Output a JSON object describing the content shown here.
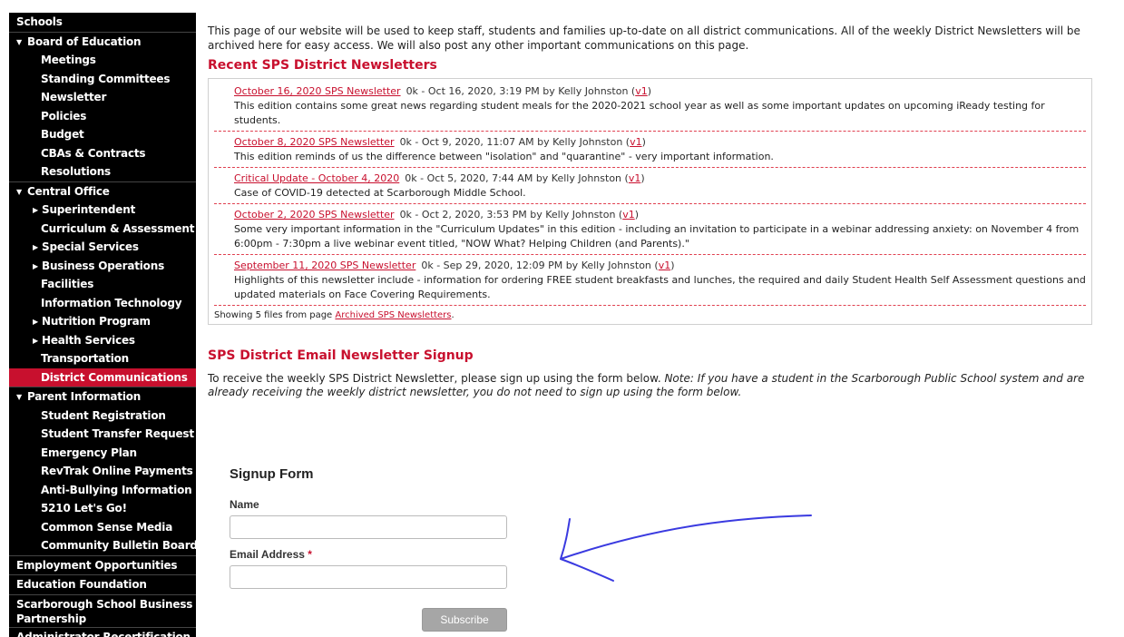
{
  "sidebar": {
    "items": [
      {
        "label": "Schools",
        "level": 0
      },
      {
        "label": "Board of Education",
        "level": 0,
        "expanded": true
      },
      {
        "label": "Meetings",
        "level": 1
      },
      {
        "label": "Standing Committees",
        "level": 1
      },
      {
        "label": "Newsletter",
        "level": 1
      },
      {
        "label": "Policies",
        "level": 1
      },
      {
        "label": "Budget",
        "level": 1
      },
      {
        "label": "CBAs & Contracts",
        "level": 1
      },
      {
        "label": "Resolutions",
        "level": 1
      },
      {
        "label": "Central Office",
        "level": 0,
        "expanded": true
      },
      {
        "label": "Superintendent",
        "level": 2
      },
      {
        "label": "Curriculum & Assessment",
        "level": 1
      },
      {
        "label": "Special Services",
        "level": 2
      },
      {
        "label": "Business Operations",
        "level": 2
      },
      {
        "label": "Facilities",
        "level": 1
      },
      {
        "label": "Information Technology",
        "level": 1
      },
      {
        "label": "Nutrition Program",
        "level": 2
      },
      {
        "label": "Health Services",
        "level": 2
      },
      {
        "label": "Transportation",
        "level": 1
      },
      {
        "label": "District Communications",
        "level": 1,
        "active": true
      },
      {
        "label": "Parent Information",
        "level": 0,
        "expanded": true
      },
      {
        "label": "Student Registration",
        "level": 1
      },
      {
        "label": "Student Transfer Request",
        "level": 1
      },
      {
        "label": "Emergency Plan",
        "level": 1
      },
      {
        "label": "RevTrak Online Payments",
        "level": 1
      },
      {
        "label": "Anti-Bullying Information",
        "level": 1
      },
      {
        "label": "5210 Let's Go!",
        "level": 1
      },
      {
        "label": "Common Sense Media",
        "level": 1
      },
      {
        "label": "Community Bulletin Board",
        "level": 1
      },
      {
        "label": "Employment Opportunities",
        "level": 0
      },
      {
        "label": "Education Foundation",
        "level": 0
      },
      {
        "label": "Scarborough School Business Partnership",
        "level": 0,
        "wrap": true
      },
      {
        "label": "Administrator Recertification",
        "level": 0
      }
    ],
    "active_color": "#c8102e"
  },
  "main": {
    "intro": "This page of our website will be used to keep staff, students and families up-to-date on all district communications.  All of the weekly District Newsletters will be archived here for easy access.  We will also post any other important communications on this page.",
    "recent_title": "Recent SPS District Newsletters",
    "newsletters": [
      {
        "link": "October 16, 2020 SPS Newsletter",
        "meta_pre": "0k - Oct 16, 2020, 3:19 PM by Kelly Johnston (",
        "version": "v1",
        "meta_post": ")",
        "desc": "This edition contains some great news regarding student meals for the 2020-2021 school year as well as some important updates on upcoming iReady testing for students."
      },
      {
        "link": "October 8, 2020 SPS Newsletter",
        "meta_pre": "0k - Oct 9, 2020, 11:07 AM by Kelly Johnston (",
        "version": "v1",
        "meta_post": ")",
        "desc": "This edition reminds of us the difference between \"isolation\" and \"quarantine\" - very important information."
      },
      {
        "link": "Critical Update - October 4, 2020",
        "meta_pre": "0k - Oct 5, 2020, 7:44 AM by Kelly Johnston (",
        "version": "v1",
        "meta_post": ")",
        "desc": "Case of COVID-19 detected at Scarborough Middle School."
      },
      {
        "link": "October 2, 2020 SPS Newsletter",
        "meta_pre": "0k - Oct 2, 2020, 3:53 PM by Kelly Johnston (",
        "version": "v1",
        "meta_post": ")",
        "desc": "Some very important information in the \"Curriculum Updates\" in this edition - including an invitation to participate in a webinar addressing anxiety: on November 4 from 6:00pm - 7:30pm a live webinar event titled, \"NOW What? Helping Children (and Parents).\""
      },
      {
        "link": "September 11, 2020 SPS Newsletter",
        "meta_pre": "0k - Sep 29, 2020, 12:09 PM by Kelly Johnston (",
        "version": "v1",
        "meta_post": ")",
        "desc": "Highlights of this newsletter include - information for ordering FREE student breakfasts and lunches, the required and daily Student Health Self Assessment questions and updated materials on Face Covering Requirements."
      }
    ],
    "showing_prefix": "Showing 5 files from page ",
    "showing_link": "Archived SPS Newsletters",
    "showing_suffix": ".",
    "signup_title": "SPS District Email Newsletter Signup",
    "signup_text_plain": "To receive the weekly SPS District Newsletter, please sign up using the form below. ",
    "signup_text_note": "Note: If you have a student in the Scarborough Public School system and are already receiving the weekly district newsletter, you do not need to sign up using the form below."
  },
  "form": {
    "title": "Signup Form",
    "name_label": "Name",
    "name_value": "",
    "email_label": "Email Address",
    "required_mark": "*",
    "email_value": "",
    "subscribe_label": "Subscribe"
  },
  "annotation": {
    "arrow_color": "#3a3ae0"
  }
}
